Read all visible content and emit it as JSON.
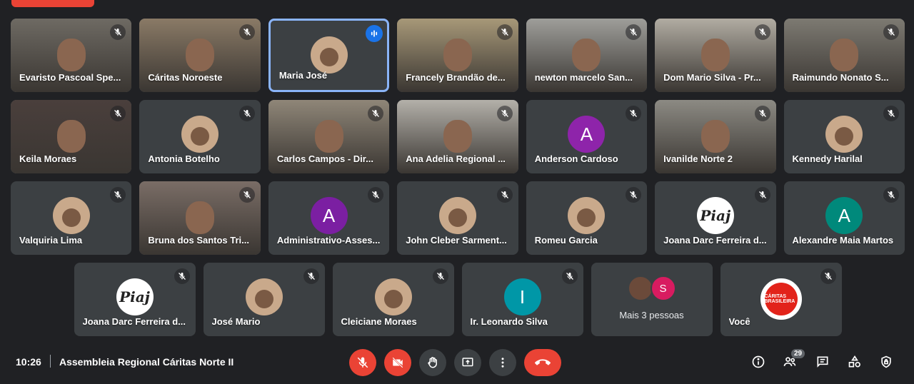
{
  "meeting": {
    "time": "10:26",
    "separator": "|",
    "title": "Assembleia Regional Cáritas Norte II",
    "participant_count": "29"
  },
  "rows": [
    [
      {
        "name": "Evaristo Pascoal Spe...",
        "type": "video",
        "bg": "#6e6a63"
      },
      {
        "name": "Cáritas Noroeste",
        "type": "video",
        "bg": "#8a7a66"
      },
      {
        "name": "Maria José",
        "type": "avatar-photo",
        "speaking": true
      },
      {
        "name": "Francely Brandão de...",
        "type": "video",
        "bg": "#a79878"
      },
      {
        "name": "newton marcelo San...",
        "type": "video",
        "bg": "#9e9e9a"
      },
      {
        "name": "Dom Mario Silva - Pr...",
        "type": "video",
        "bg": "#b1aca2"
      },
      {
        "name": "Raimundo Nonato S...",
        "type": "video",
        "bg": "#7d7a72"
      }
    ],
    [
      {
        "name": "Keila Moraes",
        "type": "video",
        "bg": "#4a3f3c"
      },
      {
        "name": "Antonia Botelho",
        "type": "avatar-photo"
      },
      {
        "name": "Carlos Campos - Dir...",
        "type": "video",
        "bg": "#8f8678"
      },
      {
        "name": "Ana Adelia Regional ...",
        "type": "video",
        "bg": "#b3b0a9"
      },
      {
        "name": "Anderson Cardoso",
        "type": "avatar-letter",
        "letter": "A",
        "color": "#8e24aa"
      },
      {
        "name": "Ivanilde Norte 2",
        "type": "video",
        "bg": "#8c8a83"
      },
      {
        "name": "Kennedy Harilal",
        "type": "avatar-photo"
      }
    ],
    [
      {
        "name": "Valquiria Lima",
        "type": "avatar-photo"
      },
      {
        "name": "Bruna dos Santos Tri...",
        "type": "video",
        "bg": "#7a6d66"
      },
      {
        "name": "Administrativo-Asses...",
        "type": "avatar-letter",
        "letter": "A",
        "color": "#7b1fa2"
      },
      {
        "name": "John Cleber Sarment...",
        "type": "avatar-photo"
      },
      {
        "name": "Romeu Garcia",
        "type": "avatar-photo"
      },
      {
        "name": "Joana Darc Ferreira d...",
        "type": "avatar-logo",
        "logo": "Piaj"
      },
      {
        "name": "Alexandre Maia Martos",
        "type": "avatar-letter",
        "letter": "A",
        "color": "#00897b"
      }
    ],
    [
      {
        "name": "Joana Darc Ferreira d...",
        "type": "avatar-logo",
        "logo": "Piaj"
      },
      {
        "name": "José Mario",
        "type": "avatar-photo"
      },
      {
        "name": "Cleiciane Moraes",
        "type": "avatar-photo"
      },
      {
        "name": "Ir. Leonardo Silva",
        "type": "avatar-letter",
        "letter": "I",
        "color": "#0097a7"
      },
      {
        "name": "Mais 3 pessoas",
        "type": "more",
        "letter": "S"
      },
      {
        "name": "Você",
        "type": "caritas",
        "logo": "CÁRITAS BRASILEIRA"
      }
    ]
  ],
  "controls": [
    {
      "name": "mic-off-icon",
      "style": "red"
    },
    {
      "name": "camera-off-icon",
      "style": "red"
    },
    {
      "name": "raise-hand-icon",
      "style": "gray"
    },
    {
      "name": "present-icon",
      "style": "gray"
    },
    {
      "name": "more-options-icon",
      "style": "gray"
    },
    {
      "name": "hang-up-icon",
      "style": "hangup"
    }
  ],
  "right_icons": [
    "info-icon",
    "people-icon",
    "chat-icon",
    "activities-icon",
    "host-controls-icon"
  ]
}
